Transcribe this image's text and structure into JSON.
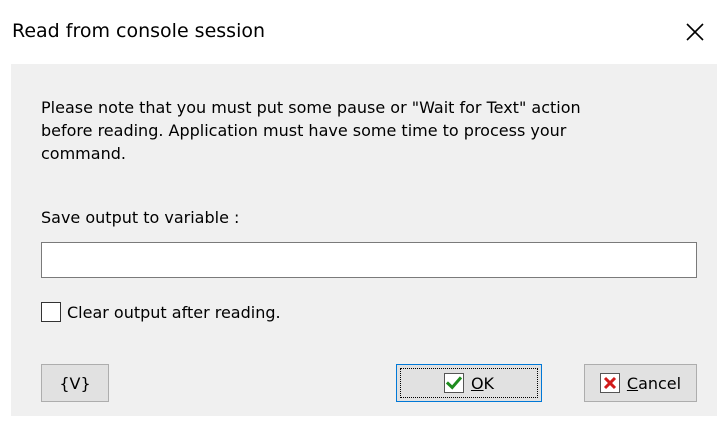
{
  "window": {
    "title": "Read from console session"
  },
  "content": {
    "note_lines": [
      "Please note that you must put some pause or \"Wait for Text\" action",
      "before reading. Application must have some time to process your",
      "command."
    ],
    "variable_label": "Save output to variable :",
    "variable_value": "",
    "checkbox_label": "Clear output after reading.",
    "checkbox_checked": false
  },
  "buttons": {
    "variable_label": "{V}",
    "ok_mnemonic": "O",
    "ok_rest": "K",
    "cancel_mnemonic": "C",
    "cancel_rest": "ancel"
  },
  "icons": {
    "close": "close-icon",
    "ok": "checkmark-icon",
    "cancel": "cross-icon"
  },
  "colors": {
    "client_bg": "#f0f0f0",
    "button_bg": "#e1e1e1",
    "ok_border": "#0078d7",
    "check_green": "#1e8c1e",
    "cancel_red": "#d11b1b"
  }
}
